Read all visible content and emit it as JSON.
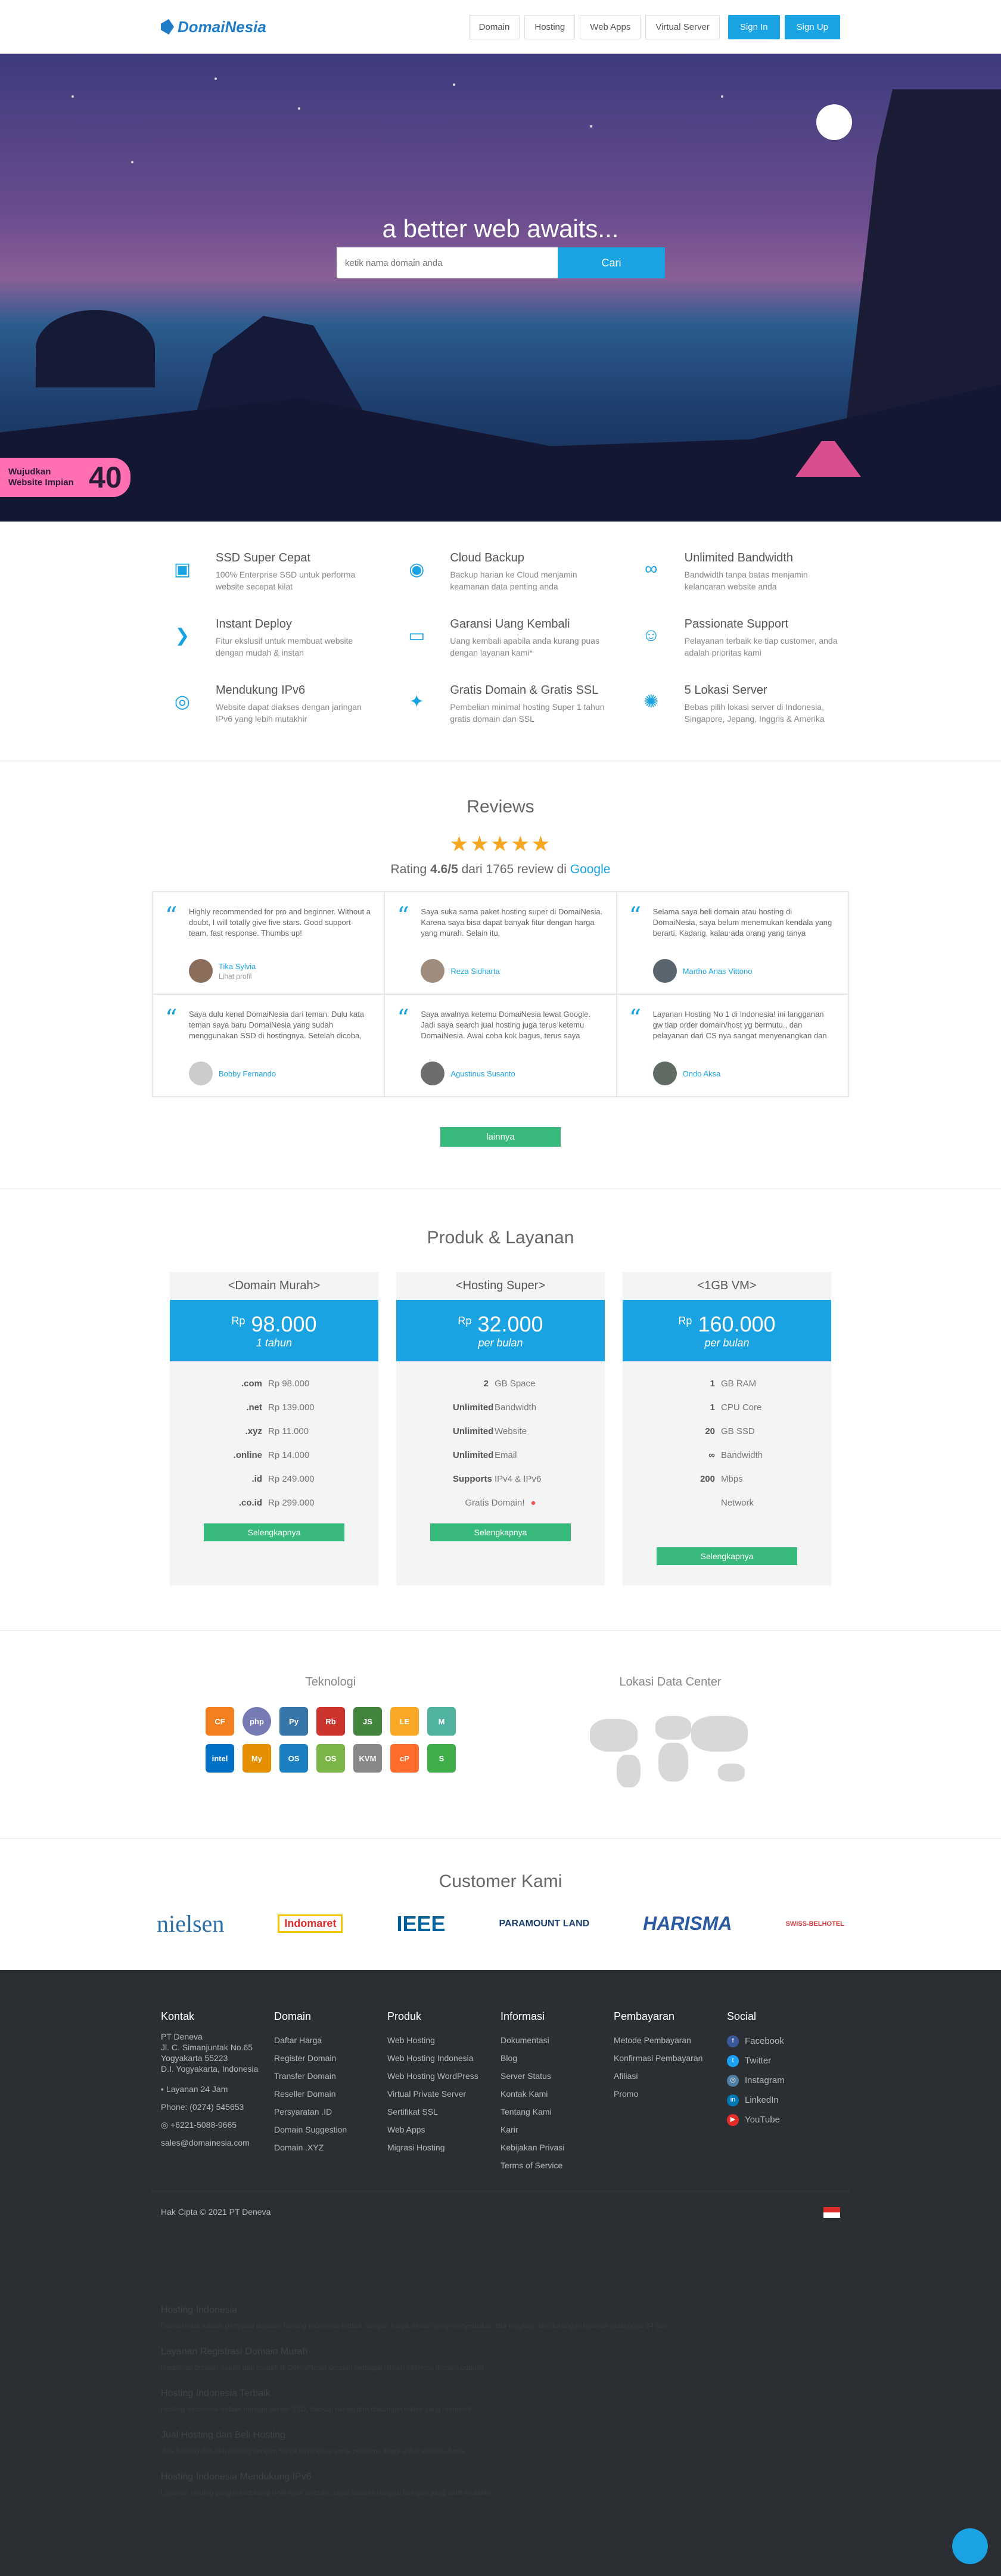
{
  "header": {
    "logo": "DomaiNesia",
    "nav": [
      "Domain",
      "Hosting",
      "Web Apps",
      "Virtual Server"
    ],
    "signin": "Sign In",
    "signup": "Sign Up"
  },
  "hero": {
    "title": "a better web awaits...",
    "search_placeholder": "ketik nama domain anda",
    "search_button": "Cari",
    "promo_text": "Wujudkan Website Impian",
    "promo_number": "40"
  },
  "features": [
    {
      "icon": "ssd-icon",
      "title": "SSD Super Cepat",
      "desc": "100% Enterprise SSD untuk performa website secepat kilat"
    },
    {
      "icon": "backup-icon",
      "title": "Cloud Backup",
      "desc": "Backup harian ke Cloud menjamin keamanan data penting anda"
    },
    {
      "icon": "infinity-icon",
      "title": "Unlimited Bandwidth",
      "desc": "Bandwidth tanpa batas menjamin kelancaran website anda"
    },
    {
      "icon": "deploy-icon",
      "title": "Instant Deploy",
      "desc": "Fitur ekslusif untuk membuat website dengan mudah & instan"
    },
    {
      "icon": "wallet-icon",
      "title": "Garansi Uang Kembali",
      "desc": "Uang kembali apabila anda kurang puas dengan layanan kami*"
    },
    {
      "icon": "support-icon",
      "title": "Passionate Support",
      "desc": "Pelayanan terbaik ke tiap customer, anda adalah prioritas kami"
    },
    {
      "icon": "ipv6-icon",
      "title": "Mendukung IPv6",
      "desc": "Website dapat diakses dengan jaringan IPv6 yang lebih mutakhir"
    },
    {
      "icon": "gift-icon",
      "title": "Gratis Domain & Gratis SSL",
      "desc": "Pembelian minimal hosting Super 1 tahun gratis domain dan SSL"
    },
    {
      "icon": "servers-icon",
      "title": "5 Lokasi Server",
      "desc": "Bebas pilih lokasi server di Indonesia, Singapore, Jepang, Inggris & Amerika"
    }
  ],
  "reviews": {
    "title": "Reviews",
    "stars": "★★★★★",
    "rating_prefix": "Rating ",
    "rating_value": "4.6/5",
    "rating_middle": " dari 1765 review di ",
    "rating_source": "Google",
    "items": [
      {
        "text": "Highly recommended for pro and beginner. Without a doubt, I will totally give five stars. Good support team, fast response. Thumbs up!",
        "name": "Tika Sylvia",
        "sub": "Lihat profil"
      },
      {
        "text": "Saya suka sama paket hosting super di DomaiNesia. Karena saya bisa dapat banyak fitur dengan harga yang murah. Selain itu,",
        "name": "Reza Sidharta",
        "sub": ""
      },
      {
        "text": "Selama saya beli domain atau hosting di DomaiNesia, saya belum menemukan kendala yang berarti. Kadang, kalau ada orang yang tanya",
        "name": "Martho Anas Vittono",
        "sub": ""
      },
      {
        "text": "Saya dulu kenal DomaiNesia dari teman. Dulu kata teman saya baru DomaiNesia yang sudah menggunakan SSD di hostingnya. Setelah dicoba,",
        "name": "Bobby Fernando",
        "sub": ""
      },
      {
        "text": "Saya awalnya ketemu DomaiNesia lewat Google. Jadi saya search jual hosting juga terus ketemu DomaiNesia. Awal coba kok bagus, terus saya",
        "name": "Agustinus Susanto",
        "sub": ""
      },
      {
        "text": "Layanan Hosting No 1 di Indonesia! ini langganan gw tiap order domain/host yg bermutu., dan pelayanan dari CS nya sangat menyenangkan dan",
        "name": "Ondo Aksa",
        "sub": ""
      }
    ],
    "more": "lainnya"
  },
  "products": {
    "title": "Produk & Layanan",
    "plans": [
      {
        "name": "<Domain Murah>",
        "currency": "Rp",
        "price": "98.000",
        "period": "1 tahun",
        "rows": [
          [
            "",
            ".com",
            "Rp 98.000"
          ],
          [
            "",
            ".net",
            "Rp 139.000"
          ],
          [
            "",
            ".xyz",
            "Rp 11.000"
          ],
          [
            "",
            ".online",
            "Rp 14.000"
          ],
          [
            "",
            ".id",
            "Rp 249.000"
          ],
          [
            "",
            ".co.id",
            "Rp 299.000"
          ]
        ],
        "button": "Selengkapnya"
      },
      {
        "name": "<Hosting Super>",
        "currency": "Rp",
        "price": "32.000",
        "period": "per bulan",
        "rows": [
          [
            "",
            "2",
            "GB Space"
          ],
          [
            "",
            "Unlimited",
            "Bandwidth"
          ],
          [
            "",
            "Unlimited",
            "Website"
          ],
          [
            "",
            "Unlimited",
            "Email"
          ],
          [
            "",
            "Supports",
            "IPv4 & IPv6"
          ],
          [
            "",
            "",
            "Gratis Domain!"
          ]
        ],
        "button": "Selengkapnya"
      },
      {
        "name": "<1GB VM>",
        "currency": "Rp",
        "price": "160.000",
        "period": "per bulan",
        "rows": [
          [
            "",
            "1",
            "GB RAM"
          ],
          [
            "",
            "1",
            "CPU Core"
          ],
          [
            "",
            "20",
            "GB SSD"
          ],
          [
            "",
            "∞",
            "Bandwidth"
          ],
          [
            "",
            "200",
            "Mbps Network"
          ]
        ],
        "button": "Selengkapnya"
      }
    ]
  },
  "tech": {
    "title": "Teknologi",
    "logos": [
      "cloudflare",
      "php",
      "python",
      "ruby",
      "nodejs",
      "lets-encrypt",
      "m",
      "intel",
      "mysql",
      "openstack",
      "openstack2",
      "kvm",
      "cpanel",
      "softaculous"
    ],
    "dc_title": "Lokasi Data Center"
  },
  "customers": {
    "title": "Customer Kami",
    "logos": [
      "nielsen",
      "Indomaret",
      "IEEE",
      "PARAMOUNT LAND",
      "HARISMA",
      "SWISS-BELHOTEL"
    ]
  },
  "footer": {
    "contact_title": "Kontak",
    "contact_lines": [
      "PT Deneva",
      "Jl. C. Simanjuntak No.65",
      "Yogyakarta 55223",
      "D.I. Yogyakarta, Indonesia"
    ],
    "contact_extra": [
      "Layanan 24 Jam",
      "Phone: (0274) 545653",
      "+6221-5088-9665",
      "sales@domainesia.com"
    ],
    "domain_title": "Domain",
    "domain_links": [
      "Daftar Harga",
      "Register Domain",
      "Transfer Domain",
      "Reseller Domain",
      "Persyaratan .ID",
      "Domain Suggestion",
      "Domain .XYZ"
    ],
    "produk_title": "Produk",
    "produk_links": [
      "Web Hosting",
      "Web Hosting Indonesia",
      "Web Hosting WordPress",
      "Virtual Private Server",
      "Sertifikat SSL",
      "Web Apps",
      "Migrasi Hosting"
    ],
    "info_title": "Informasi",
    "info_links": [
      "Dokumentasi",
      "Blog",
      "Server Status",
      "Kontak Kami",
      "Tentang Kami",
      "Karir",
      "Kebijakan Privasi",
      "Terms of Service"
    ],
    "bayar_title": "Pembayaran",
    "bayar_links": [
      "Metode Pembayaran",
      "Konfirmasi Pembayaran",
      "Afiliasi",
      "Promo"
    ],
    "social_title": "Social",
    "social_links": [
      "Facebook",
      "Twitter",
      "Instagram",
      "LinkedIn",
      "YouTube"
    ],
    "copyright": "Hak Cipta © 2021 PT Deneva",
    "seo": [
      {
        "title": "Hosting Indonesia",
        "text": "DomaiNesia adalah penyedia layanan hosting Indonesia terbaik dengan harga murah yang menyediakan fitur lengkap dan dukungan layanan pelanggan 24 jam."
      },
      {
        "title": "Layanan Registrasi Domain Murah",
        "text": "Registrasi domain murah dan mudah di DomaiNesia dengan berbagai pilihan ekstensi domain populer."
      },
      {
        "title": "Hosting Indonesia Terbaik",
        "text": "Hosting Indonesia terbaik dengan server SSD, backup harian dan dukungan teknis yang responsif."
      },
      {
        "title": "Jual Hosting dan Beli Hosting",
        "text": "Jual hosting dan beli hosting dengan harga terjangkau serta performa tinggi untuk website Anda."
      },
      {
        "title": "Hosting Indonesia Mendukung IPv6",
        "text": "Layanan hosting yang mendukung IPv6 agar website dapat diakses dengan jaringan yang lebih mutakhir."
      }
    ]
  }
}
